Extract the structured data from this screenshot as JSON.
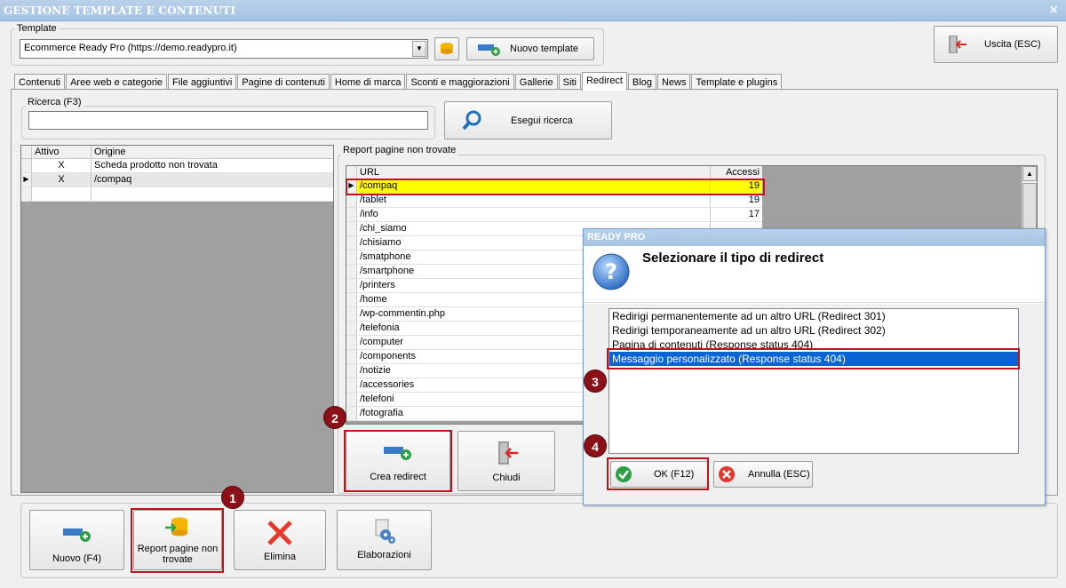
{
  "window": {
    "title": "GESTIONE TEMPLATE E CONTENUTI",
    "close_glyph": "✕"
  },
  "template_group": {
    "label": "Template",
    "selected": "Ecommerce Ready Pro (https://demo.readypro.it)",
    "new_label": "Nuovo template"
  },
  "exit_button": "Uscita (ESC)",
  "tabs": [
    {
      "label": "Contenuti"
    },
    {
      "label": "Aree web e categorie"
    },
    {
      "label": "File aggiuntivi"
    },
    {
      "label": "Pagine di contenuti"
    },
    {
      "label": "Home di marca"
    },
    {
      "label": "Sconti e maggiorazioni"
    },
    {
      "label": "Gallerie"
    },
    {
      "label": "Siti"
    },
    {
      "label": "Redirect",
      "active": true
    },
    {
      "label": "Blog"
    },
    {
      "label": "News"
    },
    {
      "label": "Template e plugins"
    }
  ],
  "search": {
    "label": "Ricerca (F3)",
    "value": "",
    "button": "Esegui ricerca"
  },
  "redirect_grid": {
    "columns": [
      "Attivo",
      "Origine"
    ],
    "rows": [
      {
        "attivo": "X",
        "origine": "Scheda prodotto non trovata"
      },
      {
        "attivo": "X",
        "origine": "/compaq",
        "current": true
      },
      {
        "attivo": "",
        "origine": ""
      }
    ]
  },
  "report": {
    "label": "Report pagine non trovate",
    "columns": [
      "URL",
      "Accessi"
    ],
    "rows": [
      {
        "url": "/compaq",
        "count": "19"
      },
      {
        "url": "/tablet",
        "count": "19"
      },
      {
        "url": "/info",
        "count": "17"
      },
      {
        "url": "/chi_siamo",
        "count": ""
      },
      {
        "url": "/chisiamo",
        "count": ""
      },
      {
        "url": "/smatphone",
        "count": ""
      },
      {
        "url": "/smartphone",
        "count": ""
      },
      {
        "url": "/printers",
        "count": ""
      },
      {
        "url": "/home",
        "count": ""
      },
      {
        "url": "/wp-commentin.php",
        "count": ""
      },
      {
        "url": "/telefonia",
        "count": ""
      },
      {
        "url": "/computer",
        "count": ""
      },
      {
        "url": "/components",
        "count": ""
      },
      {
        "url": "/notizie",
        "count": ""
      },
      {
        "url": "/accessories",
        "count": ""
      },
      {
        "url": "/telefoni",
        "count": ""
      },
      {
        "url": "/fotografia",
        "count": ""
      }
    ],
    "create_button": "Crea redirect",
    "close_button": "Chiudi"
  },
  "dialog": {
    "title": "READY PRO",
    "heading": "Selezionare il tipo di redirect",
    "options": [
      "Redirigi permanentemente ad un altro URL (Redirect 301)",
      "Redirigi temporaneamente ad un altro URL (Redirect 302)",
      "Pagina di contenuti (Response status 404)",
      "Messaggio personalizzato (Response status 404)"
    ],
    "selected_index": 3,
    "ok": "OK (F12)",
    "cancel": "Annulla (ESC)"
  },
  "bottom_toolbar": {
    "new": "Nuovo (F4)",
    "report": "Report pagine non trovate",
    "delete": "Elimina",
    "process": "Elaborazioni"
  },
  "step_markers": [
    "1",
    "2",
    "3",
    "4"
  ],
  "colors": {
    "highlight_row": "#ffff00",
    "annotation_red": "#c0141c",
    "step_circle": "#8b1017",
    "selection_blue": "#0a64d4"
  }
}
